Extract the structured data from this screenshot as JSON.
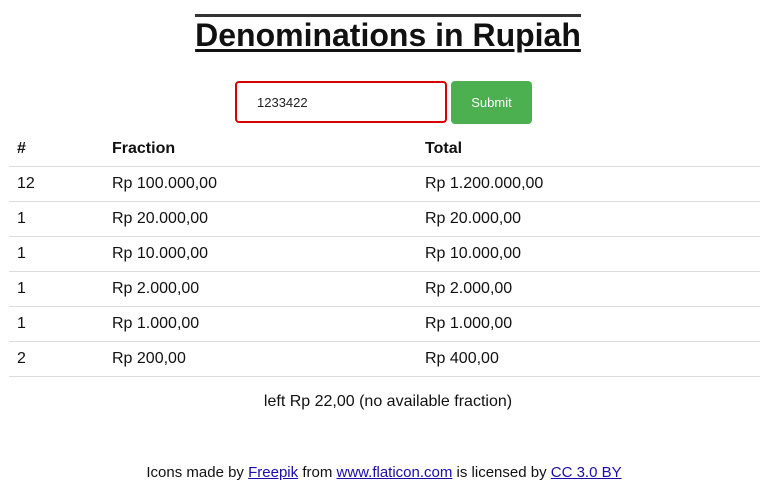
{
  "header": {
    "title": "Denominations in Rupiah"
  },
  "form": {
    "amount_value": "1233422",
    "submit_label": "Submit"
  },
  "table": {
    "headers": [
      "#",
      "Fraction",
      "Total"
    ],
    "rows": [
      {
        "count": "12",
        "fraction": "Rp 100.000,00",
        "total": "Rp 1.200.000,00"
      },
      {
        "count": "1",
        "fraction": "Rp 20.000,00",
        "total": "Rp 20.000,00"
      },
      {
        "count": "1",
        "fraction": "Rp 10.000,00",
        "total": "Rp 10.000,00"
      },
      {
        "count": "1",
        "fraction": "Rp 2.000,00",
        "total": "Rp 2.000,00"
      },
      {
        "count": "1",
        "fraction": "Rp 1.000,00",
        "total": "Rp 1.000,00"
      },
      {
        "count": "2",
        "fraction": "Rp 200,00",
        "total": "Rp 400,00"
      }
    ]
  },
  "leftover": "left Rp 22,00 (no available fraction)",
  "footer": {
    "prefix": "Icons made by",
    "author_link": "Freepik",
    "from_text": "from",
    "site_link": "www.flaticon.com",
    "licensed_text": "is licensed by",
    "license_link": "CC 3.0 BY"
  },
  "colors": {
    "submit_bg": "#4caf50",
    "input_border": "#d80000",
    "link": "#1a0dab"
  }
}
